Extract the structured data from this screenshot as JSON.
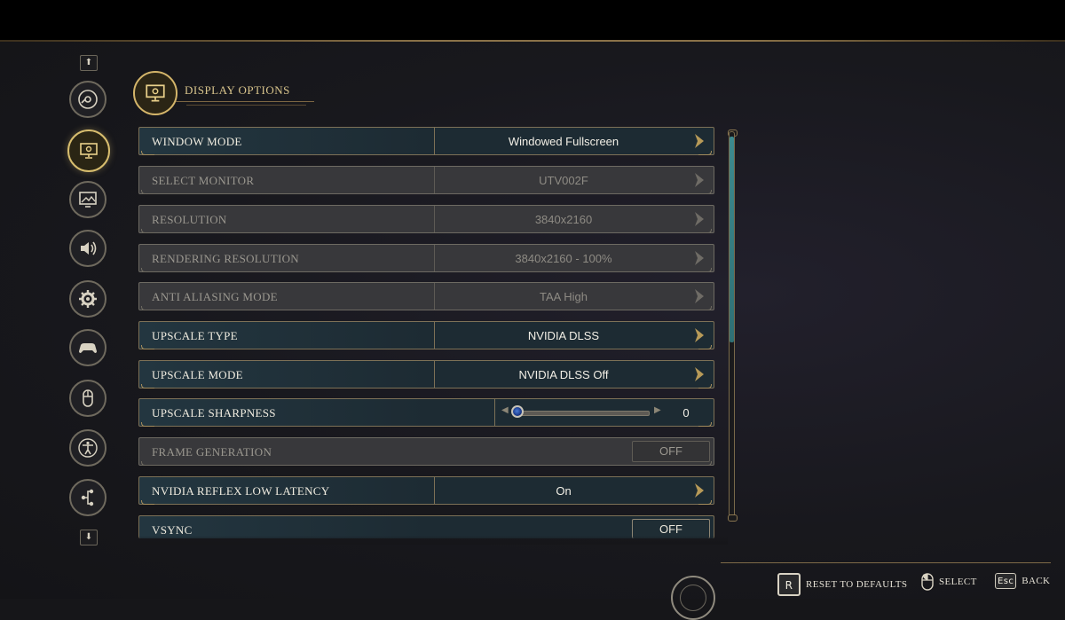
{
  "header": {
    "title": "DISPLAY OPTIONS"
  },
  "sidebar": {
    "up_arrow": "⬆",
    "down_arrow": "⬇",
    "items": [
      {
        "icon": "disc-icon",
        "active": false
      },
      {
        "icon": "display-icon",
        "active": true
      },
      {
        "icon": "graphics-icon",
        "active": false
      },
      {
        "icon": "audio-icon",
        "active": false
      },
      {
        "icon": "gameplay-gear-icon",
        "active": false
      },
      {
        "icon": "controller-icon",
        "active": false
      },
      {
        "icon": "mouse-icon",
        "active": false
      },
      {
        "icon": "accessibility-icon",
        "active": false
      },
      {
        "icon": "network-icon",
        "active": false
      }
    ]
  },
  "settings": [
    {
      "label": "WINDOW MODE",
      "value": "Windowed Fullscreen",
      "type": "select",
      "enabled": true
    },
    {
      "label": "SELECT MONITOR",
      "value": "UTV002F",
      "type": "select",
      "enabled": false
    },
    {
      "label": "RESOLUTION",
      "value": "3840x2160",
      "type": "select",
      "enabled": false
    },
    {
      "label": "RENDERING RESOLUTION",
      "value": "3840x2160 - 100%",
      "type": "select",
      "enabled": false
    },
    {
      "label": "ANTI ALIASING MODE",
      "value": "TAA High",
      "type": "select",
      "enabled": false
    },
    {
      "label": "UPSCALE TYPE",
      "value": "NVIDIA DLSS",
      "type": "select",
      "enabled": true
    },
    {
      "label": "UPSCALE MODE",
      "value": "NVIDIA DLSS Off",
      "type": "select",
      "enabled": true
    },
    {
      "label": "UPSCALE SHARPNESS",
      "value": "0",
      "type": "slider",
      "enabled": true,
      "slider_fraction": 0.0
    },
    {
      "label": "FRAME GENERATION",
      "value": "OFF",
      "type": "toggle",
      "enabled": false
    },
    {
      "label": "NVIDIA REFLEX LOW LATENCY",
      "value": "On",
      "type": "select",
      "enabled": true
    },
    {
      "label": "VSYNC",
      "value": "OFF",
      "type": "toggle",
      "enabled": true
    }
  ],
  "footer": {
    "reset": {
      "key": "R",
      "label": "RESET TO DEFAULTS"
    },
    "select": {
      "label": "SELECT"
    },
    "back": {
      "key": "Esc",
      "label": "BACK"
    }
  },
  "colors": {
    "accent_gold": "#d7bd6e",
    "row_enabled": "#1d2b33",
    "row_disabled": "#38383b",
    "scroll_thumb": "#3d8a8e"
  }
}
